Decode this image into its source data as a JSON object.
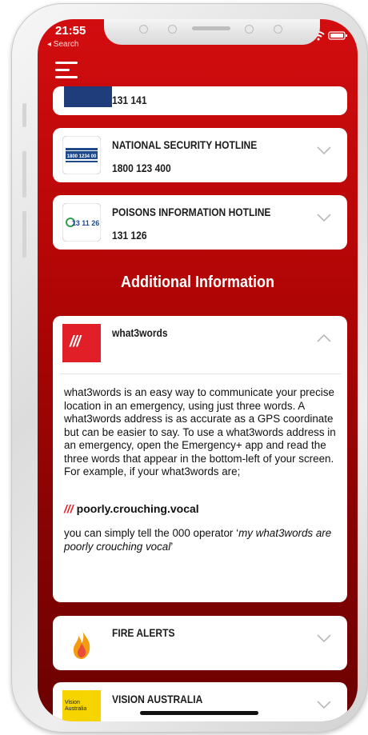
{
  "status": {
    "time": "21:55",
    "back_label": "◂ Search"
  },
  "top_partial": {
    "number": "131 141"
  },
  "hotlines": [
    {
      "title": "NATIONAL SECURITY HOTLINE",
      "number": "1800 123 400",
      "logo_text": "1800 1234 00"
    },
    {
      "title": "POISONS INFORMATION HOTLINE",
      "number": "131 126",
      "logo_text": "13 11 26"
    }
  ],
  "section_heading": "Additional Information",
  "w3w": {
    "title": "what3words",
    "logo_text": "///",
    "body": "what3words is an easy way to communicate your precise location in an emergency, using just three words. A what3words address is as accurate as a GPS coordinate but can be easier to say. To use a what3words address in an emergency, open the Emergency+ app and read the three words that appear in the bottom-left of your screen. For example, if your what3words are;",
    "address_slashes": "///",
    "address": "poorly.crouching.vocal",
    "tip_prefix": "you can simply tell the 000 operator ‘",
    "tip_italic": "my what3words are poorly crouching vocal",
    "tip_suffix": "’"
  },
  "fire": {
    "title": "FIRE ALERTS"
  },
  "vision": {
    "title": "VISION AUSTRALIA",
    "logo_text": "Vision Australia"
  },
  "colors": {
    "brand_red": "#c50a0b",
    "w3w_red": "#e11f26"
  },
  "icons": [
    "menu-icon",
    "chevron-down-icon",
    "chevron-up-icon",
    "fire-icon",
    "wifi-icon",
    "battery-icon",
    "signal-icon"
  ]
}
